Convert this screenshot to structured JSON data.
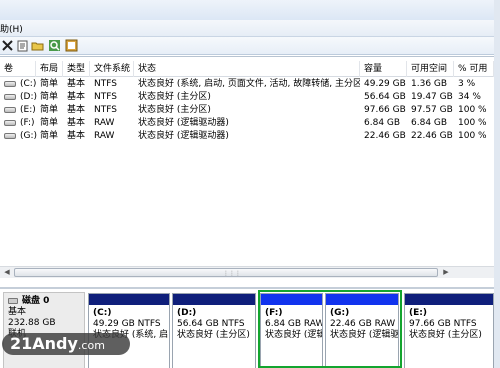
{
  "menu": {
    "help": "助(H)"
  },
  "toolbar": {
    "icons": [
      "close-icon",
      "properties-icon",
      "open-icon",
      "search-icon",
      "help-icon"
    ]
  },
  "columns": [
    "卷",
    "布局",
    "类型",
    "文件系统",
    "状态",
    "容量",
    "可用空间",
    "% 可用"
  ],
  "volumes": [
    {
      "volume": "(C:)",
      "layout": "简单",
      "type": "基本",
      "fs": "NTFS",
      "status": "状态良好 (系统, 启动, 页面文件, 活动, 故障转储, 主分区)",
      "capacity": "49.29 GB",
      "free": "1.36 GB",
      "pct": "3 %"
    },
    {
      "volume": "(D:)",
      "layout": "简单",
      "type": "基本",
      "fs": "NTFS",
      "status": "状态良好 (主分区)",
      "capacity": "56.64 GB",
      "free": "19.47 GB",
      "pct": "34 %"
    },
    {
      "volume": "(E:)",
      "layout": "简单",
      "type": "基本",
      "fs": "NTFS",
      "status": "状态良好 (主分区)",
      "capacity": "97.66 GB",
      "free": "97.57 GB",
      "pct": "100 %"
    },
    {
      "volume": "(F:)",
      "layout": "简单",
      "type": "基本",
      "fs": "RAW",
      "status": "状态良好 (逻辑驱动器)",
      "capacity": "6.84 GB",
      "free": "6.84 GB",
      "pct": "100 %"
    },
    {
      "volume": "(G:)",
      "layout": "简单",
      "type": "基本",
      "fs": "RAW",
      "status": "状态良好 (逻辑驱动器)",
      "capacity": "22.46 GB",
      "free": "22.46 GB",
      "pct": "100 %"
    }
  ],
  "scroll": {
    "left": "◀",
    "right": "▶",
    "grip": "⋮⋮⋮"
  },
  "disk": {
    "name": "磁盘 0",
    "type": "基本",
    "size": "232.88 GB",
    "state": "联机"
  },
  "partitions": [
    {
      "name": "(C:)",
      "size": "49.29 GB NTFS",
      "status": "状态良好 (系统, 启"
    },
    {
      "name": "(D:)",
      "size": "56.64 GB NTFS",
      "status": "状态良好 (主分区)"
    },
    {
      "name": "(F:)",
      "size": "6.84 GB RAW",
      "status": "状态良好 (逻辑"
    },
    {
      "name": "(G:)",
      "size": "22.46 GB RAW",
      "status": "状态良好 (逻辑驱"
    },
    {
      "name": "(E:)",
      "size": "97.66 GB NTFS",
      "status": "状态良好 (主分区)"
    }
  ],
  "watermark": {
    "text": "21Andy",
    "domain": ".com"
  },
  "colors": {
    "primary_partition": "#0f1f7b",
    "logical_drive": "#1133ee",
    "selection": "#13a52f"
  }
}
